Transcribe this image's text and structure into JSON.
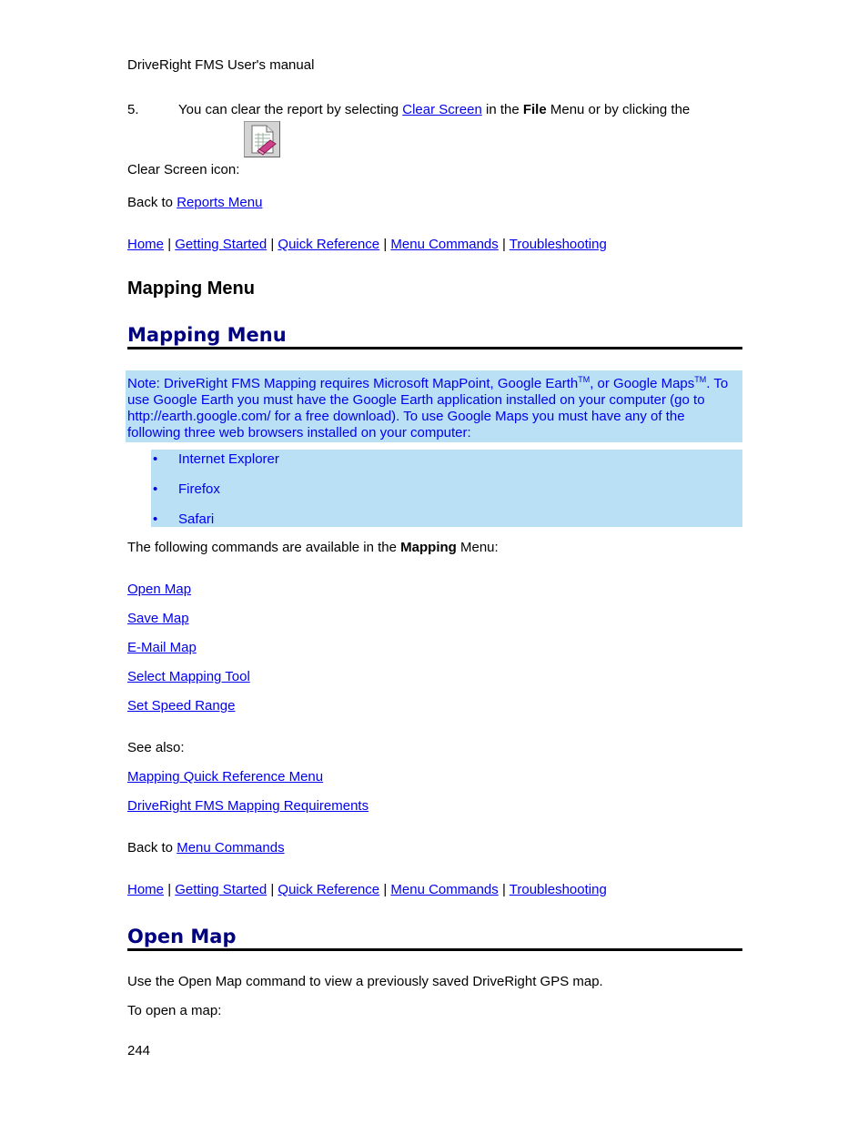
{
  "header": {
    "title": "DriveRight FMS User's manual"
  },
  "step5": {
    "number": "5.",
    "text_before": "You can clear the report by selecting ",
    "link": "Clear Screen",
    "text_mid": " in the ",
    "bold": "File",
    "text_after": " Menu or by clicking the",
    "line2": "Clear Screen icon: ",
    "icon": "clear-screen-icon"
  },
  "back_reports": {
    "prefix": "Back to ",
    "link": "Reports Menu"
  },
  "nav": {
    "items": [
      "Home",
      "Getting Started",
      "Quick Reference",
      "Menu Commands",
      "Troubleshooting"
    ],
    "separator": "|"
  },
  "plain_heading": "Mapping Menu",
  "mapping_heading": "Mapping Menu",
  "note": {
    "part1": "Note: DriveRight FMS Mapping requires Microsoft MapPoint, Google Earth",
    "tm": "TM",
    "part2": ", or Google Maps",
    "part3": ". To use Google Earth you must have the Google Earth application installed on your computer (go to http://earth.google.com/ for a free download). To use Google Maps you must have any of the following three web browsers installed on your computer:"
  },
  "browsers": [
    "Internet Explorer",
    "Firefox",
    "Safari"
  ],
  "bullet_char": "•",
  "follow": {
    "before": "The following commands are available in the ",
    "bold": "Mapping",
    "after": " Menu:"
  },
  "commands": [
    "Open Map",
    "Save Map",
    "E-Mail Map",
    "Select Mapping Tool",
    "Set Speed Range"
  ],
  "see_also": {
    "label": "See also:",
    "links": [
      "Mapping Quick Reference Menu",
      "DriveRight FMS Mapping Requirements"
    ]
  },
  "back_menu": {
    "prefix": "Back to ",
    "link": "Menu Commands"
  },
  "open_map": {
    "heading": "Open Map",
    "description": "Use the Open Map command to view a previously saved DriveRight GPS map.",
    "to_open": "To open a map:"
  },
  "page_number": "244"
}
